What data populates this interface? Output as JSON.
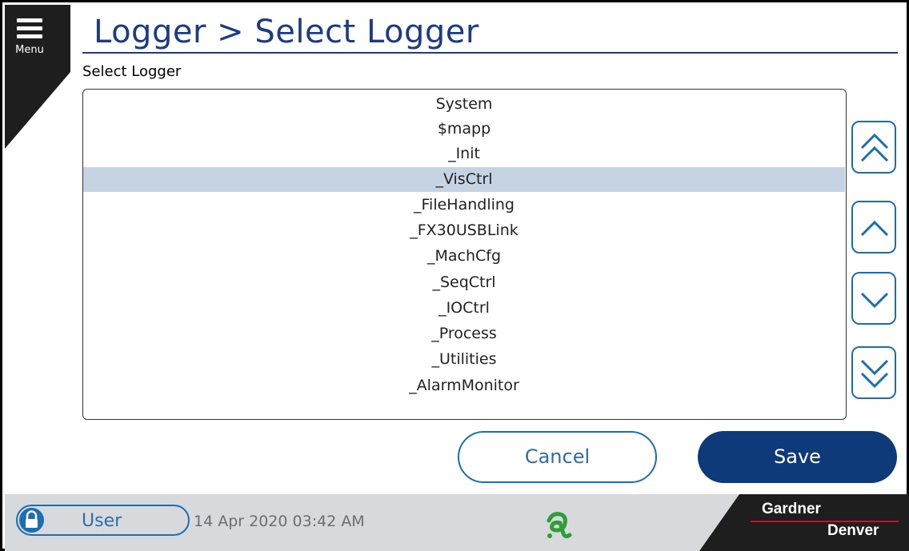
{
  "menu": {
    "label": "Menu"
  },
  "header": {
    "title": "Logger > Select Logger"
  },
  "section": {
    "label": "Select Logger"
  },
  "list": {
    "items": [
      "System",
      "$mapp",
      "_Init",
      "_VisCtrl",
      "_FileHandling",
      "_FX30USBLink",
      "_MachCfg",
      "_SeqCtrl",
      "_IOCtrl",
      "_Process",
      "_Utilities",
      "_AlarmMonitor"
    ],
    "selected": "_VisCtrl"
  },
  "scroll": {
    "page_up": "double-chevron-up-icon",
    "line_up": "chevron-up-icon",
    "line_down": "chevron-down-icon",
    "page_down": "double-chevron-down-icon"
  },
  "actions": {
    "cancel_label": "Cancel",
    "save_label": "Save"
  },
  "footer": {
    "user_label": "User",
    "datetime": "14 Apr 2020  03:42 AM",
    "brand_line1": "Gardner",
    "brand_line2": "Denver"
  },
  "colors": {
    "accent": "#1b3c82",
    "button_blue": "#1b6fb0",
    "save_bg": "#0e3a7a",
    "selected_row": "#c5d3e3",
    "logo_green": "#2e9e3a"
  }
}
